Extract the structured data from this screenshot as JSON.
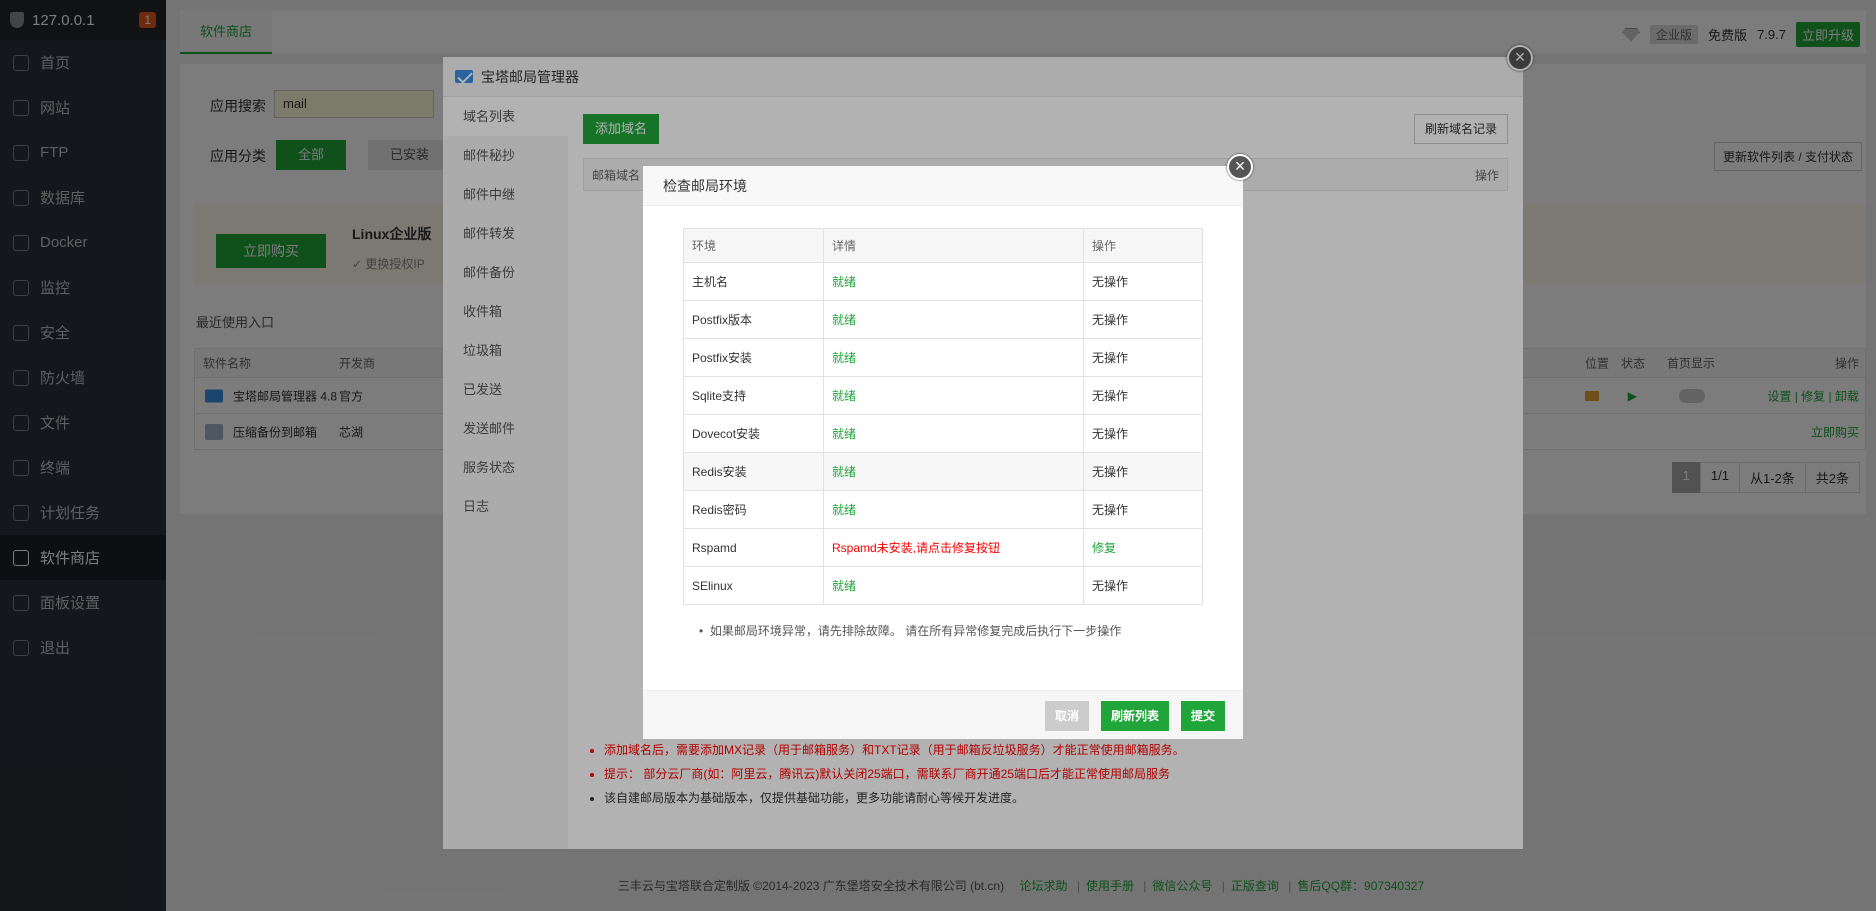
{
  "sidebar": {
    "host": "127.0.0.1",
    "badge": "1",
    "items": [
      {
        "label": "首页"
      },
      {
        "label": "网站"
      },
      {
        "label": "FTP"
      },
      {
        "label": "数据库"
      },
      {
        "label": "Docker"
      },
      {
        "label": "监控"
      },
      {
        "label": "安全"
      },
      {
        "label": "防火墙"
      },
      {
        "label": "文件"
      },
      {
        "label": "终端"
      },
      {
        "label": "计划任务"
      },
      {
        "label": "软件商店"
      },
      {
        "label": "面板设置"
      },
      {
        "label": "退出"
      }
    ]
  },
  "topbar": {
    "tab": "软件商店",
    "edition": "企业版",
    "free": "免费版",
    "version": "7.9.7",
    "upgrade": "立即升级"
  },
  "store": {
    "search_label": "应用搜索",
    "search_value": "mail",
    "category_label": "应用分类",
    "cat_all": "全部",
    "cat_installed": "已安装",
    "buy_btn": "立即购买",
    "buy_title": "Linux企业版",
    "buy_sub": "更换授权IP",
    "refresh_list": "更新软件列表 / 支付状态",
    "recent": "最近使用入口",
    "headers": {
      "name": "软件名称",
      "dev": "开发商",
      "pos": "位置",
      "status": "状态",
      "home": "首页显示",
      "op": "操作"
    },
    "rows": [
      {
        "name": "宝塔邮局管理器 4.8",
        "dev": "官方",
        "set": "设置",
        "fix": "修复",
        "uninstall": "卸载"
      },
      {
        "name": "压缩备份到邮箱",
        "dev": "芯湖",
        "buy": "立即购买"
      }
    ],
    "pager": {
      "current": "1",
      "pages": "1/1",
      "range": "从1-2条",
      "total": "共2条"
    }
  },
  "footer": {
    "copyright": "三丰云与宝塔联合定制版 ©2014-2023 广东堡塔安全技术有限公司 (bt.cn)",
    "forum": "论坛求助",
    "manual": "使用手册",
    "wechat": "微信公众号",
    "genuine": "正版查询",
    "qq": "售后QQ群：907340327"
  },
  "mail_window": {
    "title": "宝塔邮局管理器",
    "nav": [
      "域名列表",
      "邮件秘抄",
      "邮件中继",
      "邮件转发",
      "邮件备份",
      "收件箱",
      "垃圾箱",
      "已发送",
      "发送邮件",
      "服务状态",
      "日志"
    ],
    "add_domain": "添加域名",
    "refresh_domain": "刷新域名记录",
    "col_domain": "邮箱域名",
    "col_op": "操作",
    "notes": [
      "添加域名后，需要添加MX记录（用于邮箱服务）和TXT记录（用于邮箱反垃圾服务）才能正常使用邮箱服务。",
      "提示： 部分云厂商(如：阿里云，腾讯云)默认关闭25端口，需联系厂商开通25端口后才能正常使用邮局服务",
      "该自建邮局版本为基础版本，仅提供基础功能，更多功能请耐心等候开发进度。"
    ]
  },
  "check_window": {
    "title": "检查邮局环境",
    "headers": {
      "env": "环境",
      "detail": "详情",
      "op": "操作"
    },
    "rows": [
      {
        "env": "主机名",
        "detail": "就绪",
        "op": "无操作"
      },
      {
        "env": "Postfix版本",
        "detail": "就绪",
        "op": "无操作"
      },
      {
        "env": "Postfix安装",
        "detail": "就绪",
        "op": "无操作"
      },
      {
        "env": "Sqlite支持",
        "detail": "就绪",
        "op": "无操作"
      },
      {
        "env": "Dovecot安装",
        "detail": "就绪",
        "op": "无操作"
      },
      {
        "env": "Redis安装",
        "detail": "就绪",
        "op": "无操作"
      },
      {
        "env": "Redis密码",
        "detail": "就绪",
        "op": "无操作"
      },
      {
        "env": "Rspamd",
        "detail": "Rspamd未安装,请点击修复按钮",
        "op": "修复"
      },
      {
        "env": "SElinux",
        "detail": "就绪",
        "op": "无操作"
      }
    ],
    "tip": "如果邮局环境异常，请先排除故障。 请在所有异常修复完成后执行下一步操作",
    "cancel": "取消",
    "refresh": "刷新列表",
    "submit": "提交"
  },
  "colors": {
    "accent": "#20a53a",
    "error": "#ff0000",
    "sidebar": "#2c3138"
  }
}
